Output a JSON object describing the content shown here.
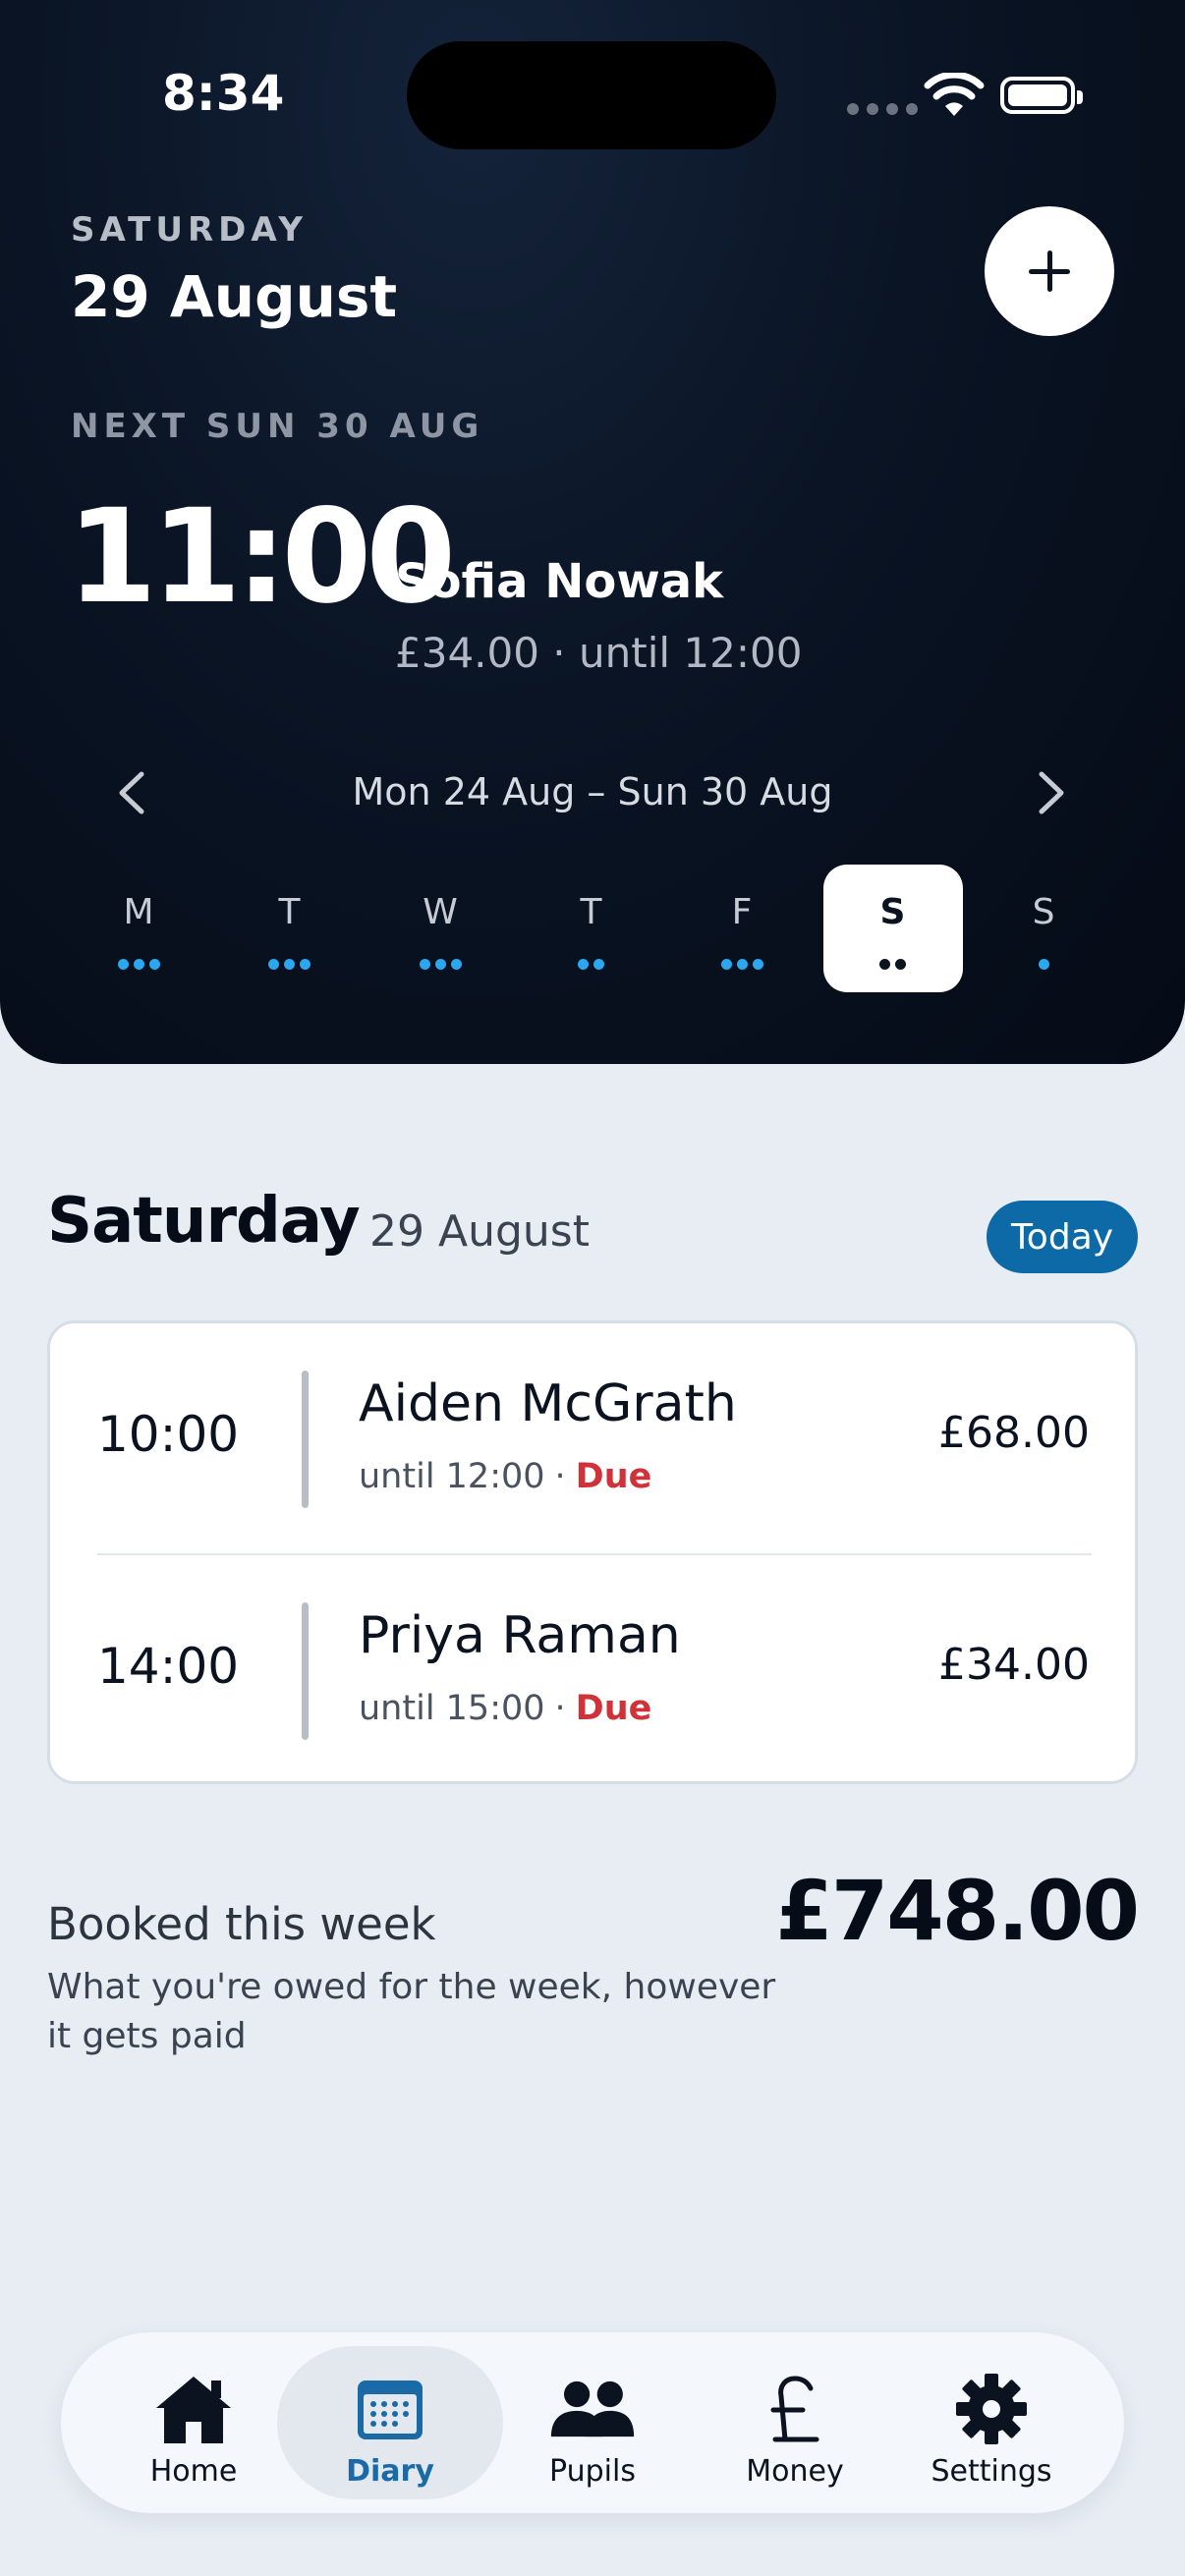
{
  "status": {
    "time": "8:34"
  },
  "header": {
    "day_label": "SATURDAY",
    "date": "29 August",
    "next_label": "NEXT SUN 30 AUG",
    "next_time": "11:00",
    "next_name": "Sofia Nowak",
    "next_detail": "£34.00 · until 12:00",
    "week_range": "Mon 24 Aug – Sun 30 Aug"
  },
  "week": {
    "days": [
      {
        "letter": "M",
        "dots": 3,
        "selected": false
      },
      {
        "letter": "T",
        "dots": 3,
        "selected": false
      },
      {
        "letter": "W",
        "dots": 3,
        "selected": false
      },
      {
        "letter": "T",
        "dots": 2,
        "selected": false
      },
      {
        "letter": "F",
        "dots": 3,
        "selected": false
      },
      {
        "letter": "S",
        "dots": 2,
        "selected": true
      },
      {
        "letter": "S",
        "dots": 1,
        "selected": false
      }
    ]
  },
  "section": {
    "day": "Saturday",
    "date": "29 August",
    "today_label": "Today"
  },
  "lessons": [
    {
      "time": "10:00",
      "name": "Aiden McGrath",
      "until": "until 12:00",
      "sep": "·",
      "status": "Due",
      "price": "£68.00"
    },
    {
      "time": "14:00",
      "name": "Priya Raman",
      "until": "until 15:00",
      "sep": "·",
      "status": "Due",
      "price": "£34.00"
    }
  ],
  "summary": {
    "title": "Booked this week",
    "description": "What you're owed for the week, however it gets paid",
    "total": "£748.00"
  },
  "tabs": [
    {
      "label": "Home",
      "icon": "home-icon",
      "active": false
    },
    {
      "label": "Diary",
      "icon": "calendar-icon",
      "active": true
    },
    {
      "label": "Pupils",
      "icon": "people-icon",
      "active": false
    },
    {
      "label": "Money",
      "icon": "pound-icon",
      "active": false
    },
    {
      "label": "Settings",
      "icon": "gear-icon",
      "active": false
    }
  ],
  "colors": {
    "accent": "#0e6aa7",
    "dot_blue": "#2aa7ee",
    "due_red": "#d0323a",
    "header_bg": "#0a1424"
  }
}
